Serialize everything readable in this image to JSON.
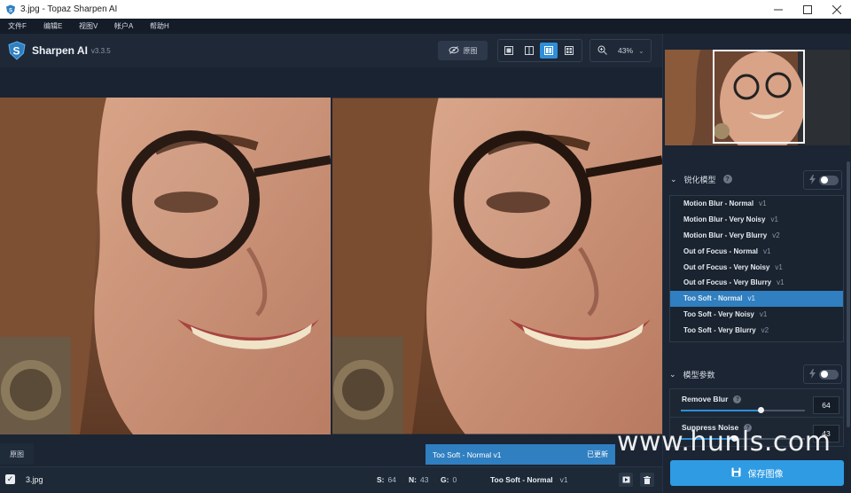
{
  "window": {
    "title": "3.jpg - Topaz Sharpen AI"
  },
  "menu": {
    "items": [
      "文件F",
      "编辑E",
      "视图V",
      "帐户A",
      "帮助H"
    ]
  },
  "app": {
    "name": "Sharpen AI",
    "version": "v3.3.5"
  },
  "toolbar": {
    "original_label": "原图",
    "zoom_value": "43%"
  },
  "canvas": {
    "original_tab": "原图"
  },
  "status": {
    "model_label": "Too Soft - Normal v1",
    "updated_label": "已更新"
  },
  "file_row": {
    "filename": "3.jpg",
    "s_label": "S:",
    "s_value": "64",
    "n_label": "N:",
    "n_value": "43",
    "g_label": "G:",
    "g_value": "0",
    "model_name": "Too Soft - Normal",
    "model_version": "v1"
  },
  "panel": {
    "model_section_title": "锐化模型",
    "models": [
      {
        "name": "Motion Blur - Normal",
        "version": "v1"
      },
      {
        "name": "Motion Blur - Very Noisy",
        "version": "v1"
      },
      {
        "name": "Motion Blur - Very Blurry",
        "version": "v2"
      },
      {
        "name": "Out of Focus - Normal",
        "version": "v1"
      },
      {
        "name": "Out of Focus - Very Noisy",
        "version": "v1"
      },
      {
        "name": "Out of Focus - Very Blurry",
        "version": "v1"
      },
      {
        "name": "Too Soft - Normal",
        "version": "v1"
      },
      {
        "name": "Too Soft - Very Noisy",
        "version": "v1"
      },
      {
        "name": "Too Soft - Very Blurry",
        "version": "v2"
      }
    ],
    "selected_model_index": 6,
    "params_section_title": "模型参数",
    "params": [
      {
        "label": "Remove Blur",
        "value": "64",
        "level": 0.64
      },
      {
        "label": "Suppress Noise",
        "value": "43",
        "level": 0.43
      }
    ],
    "save_label": "保存图像"
  },
  "watermark": "www.hunls.com",
  "colors": {
    "accent": "#2f8ed9",
    "selected": "#2f7fc1",
    "panel_bg": "#1b2533"
  },
  "icons": [
    "app-shield-icon",
    "eye-off-icon",
    "zoom-icon",
    "lightning-icon",
    "help-icon",
    "chevron-down-icon",
    "save-icon",
    "film-icon",
    "trash-icon"
  ]
}
